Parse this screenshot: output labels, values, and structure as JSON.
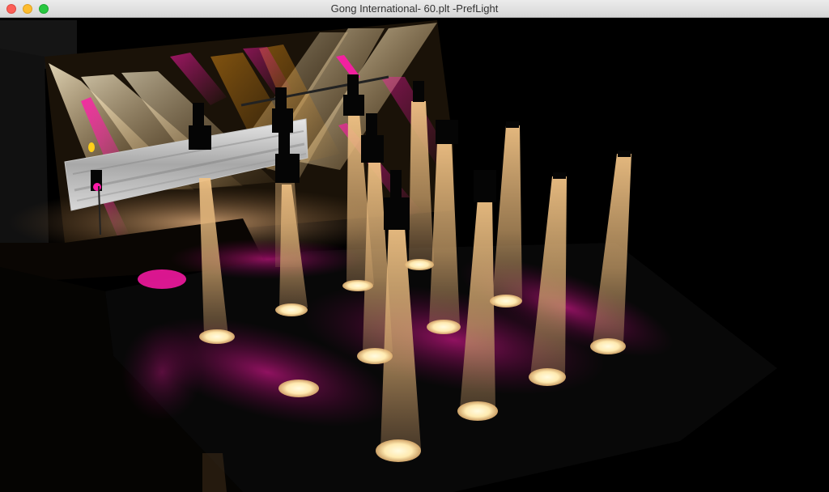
{
  "window": {
    "title": "Gong International- 60.plt -PrefLight",
    "controls": [
      "close",
      "minimize",
      "zoom"
    ]
  },
  "scene": {
    "description_icon": "3d-stage-lighting-view",
    "colors": {
      "beam_warm": "#f2c58a",
      "beam_magenta": "#ff1aa8",
      "beam_amber": "#ffa21a",
      "stage_floor": "#0d0d0d",
      "spot_glow": "#fff3c4"
    }
  }
}
